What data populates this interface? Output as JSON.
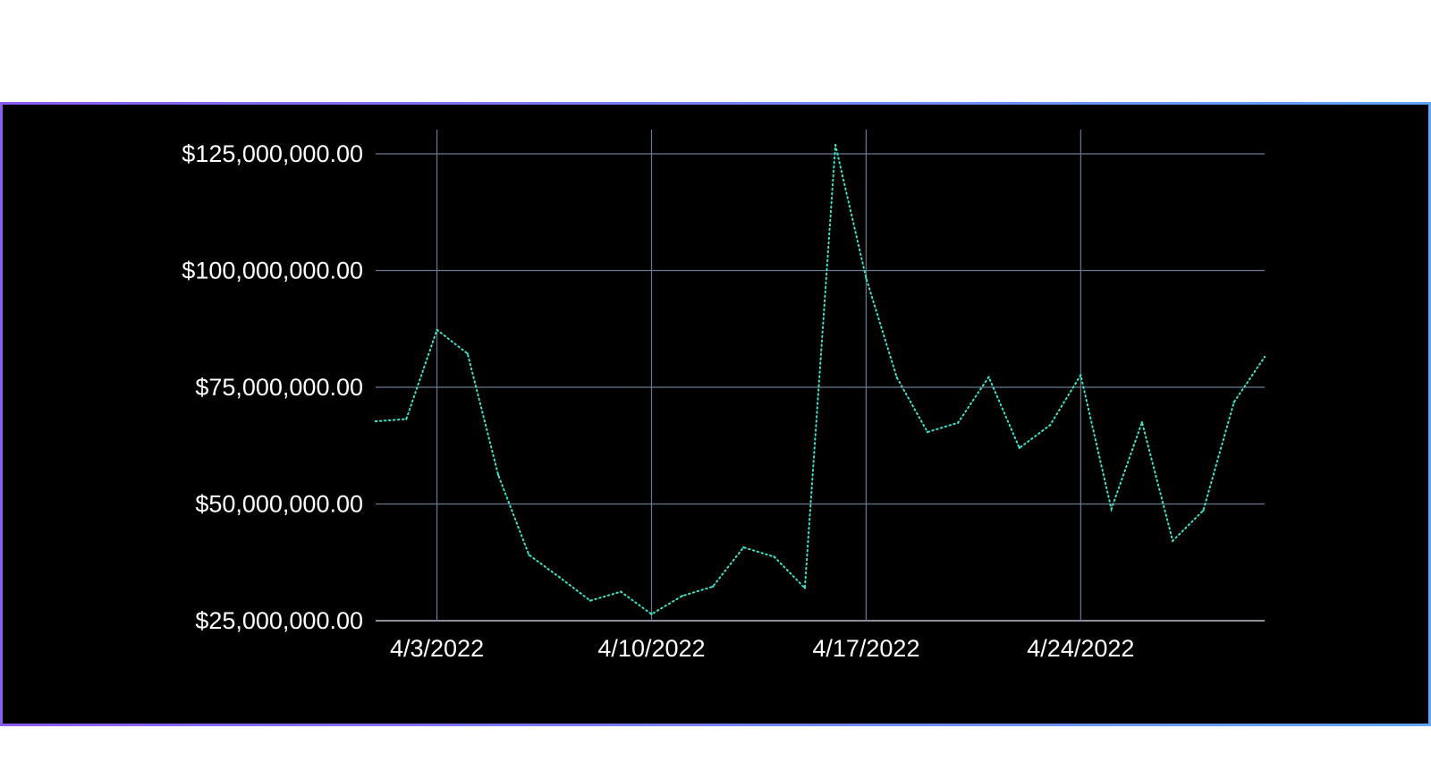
{
  "chart_data": {
    "type": "line",
    "title": "",
    "xlabel": "",
    "ylabel": "",
    "grid": true,
    "xlim": [
      "2022-04-01",
      "2022-04-30"
    ],
    "ylim": [
      25000000,
      125000000
    ],
    "y_ticks": [
      25000000,
      50000000,
      75000000,
      100000000,
      125000000
    ],
    "y_tick_labels": [
      "$25,000,000.00",
      "$50,000,000.00",
      "$75,000,000.00",
      "$100,000,000.00",
      "$125,000,000.00"
    ],
    "x_ticks": [
      "2022-04-03",
      "2022-04-10",
      "2022-04-17",
      "2022-04-24"
    ],
    "x_tick_labels": [
      "4/3/2022",
      "4/10/2022",
      "4/17/2022",
      "4/24/2022"
    ],
    "colors": {
      "line": "#3fe0c5",
      "grid": "#6b7a8f",
      "axis": "#8a8f98",
      "text": "#ffffff",
      "background": "#000000"
    },
    "series": [
      {
        "x": [
          "2022-04-01",
          "2022-04-02",
          "2022-04-03",
          "2022-04-04",
          "2022-04-05",
          "2022-04-06",
          "2022-04-07",
          "2022-04-08",
          "2022-04-09",
          "2022-04-10",
          "2022-04-11",
          "2022-04-12",
          "2022-04-13",
          "2022-04-14",
          "2022-04-15",
          "2022-04-16",
          "2022-04-17",
          "2022-04-18",
          "2022-04-19",
          "2022-04-20",
          "2022-04-21",
          "2022-04-22",
          "2022-04-23",
          "2022-04-24",
          "2022-04-25",
          "2022-04-26",
          "2022-04-27",
          "2022-04-28",
          "2022-04-29",
          "2022-04-30"
        ],
        "values": [
          67700000,
          68200000,
          87300000,
          82200000,
          56200000,
          39100000,
          34300000,
          29300000,
          31200000,
          26400000,
          30300000,
          32300000,
          40700000,
          38700000,
          32000000,
          126900000,
          98400000,
          77100000,
          65400000,
          67400000,
          77200000,
          62000000,
          66900000,
          77600000,
          48900000,
          67500000,
          42100000,
          48600000,
          71800000,
          81500000
        ]
      }
    ]
  }
}
